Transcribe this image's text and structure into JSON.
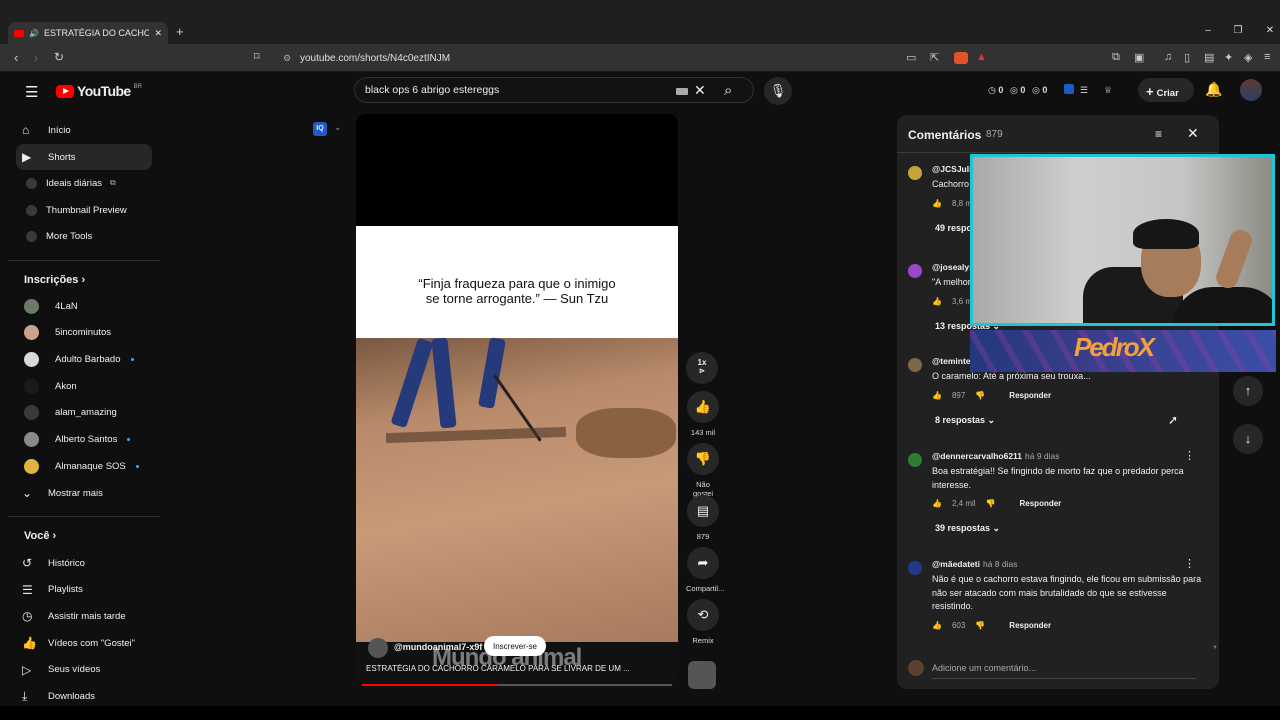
{
  "browser": {
    "tab_title": "ESTRATÉGIA DO CACHORRO",
    "url": "youtube.com/shorts/N4c0eztINJM",
    "window_controls": [
      "–",
      "❐",
      "✕"
    ]
  },
  "masthead": {
    "logo": "YouTube",
    "country": "BR",
    "search_value": "black ops 6 abrigo estereggs",
    "counters": [
      "0",
      "0",
      "0"
    ],
    "create_label": "Criar"
  },
  "sidebar": {
    "main": [
      {
        "label": "Início",
        "icon": "home-icon"
      },
      {
        "label": "Shorts",
        "icon": "shorts-icon"
      },
      {
        "label": "Ideais diárias",
        "icon": "channel-icon"
      },
      {
        "label": "Thumbnail Preview",
        "icon": "channel-icon"
      },
      {
        "label": "More Tools",
        "icon": "channel-icon"
      }
    ],
    "subscriptions_header": "Inscrições",
    "subscriptions": [
      {
        "label": "4LaN",
        "new": false,
        "color": "#6d7a6a"
      },
      {
        "label": "5incominutos",
        "new": false,
        "color": "#c9a38c"
      },
      {
        "label": "Adulto Barbado",
        "new": true,
        "color": "#d8d8d8"
      },
      {
        "label": "Akon",
        "new": false,
        "color": "#1a1a1a"
      },
      {
        "label": "alam_amazing",
        "new": false,
        "color": "#3a3a3a"
      },
      {
        "label": "Alberto Santos",
        "new": true,
        "color": "#8a8a8a"
      },
      {
        "label": "Almanaque SOS",
        "new": true,
        "color": "#e0b440"
      }
    ],
    "show_more": "Mostrar mais",
    "you_header": "Você",
    "you": [
      {
        "label": "Histórico",
        "icon": "history-icon"
      },
      {
        "label": "Playlists",
        "icon": "playlists-icon"
      },
      {
        "label": "Assistir mais tarde",
        "icon": "watch-later-icon"
      },
      {
        "label": "Vídeos com \"Gostei\"",
        "icon": "like-icon"
      },
      {
        "label": "Seus vídeos",
        "icon": "your-videos-icon"
      },
      {
        "label": "Downloads",
        "icon": "download-icon"
      }
    ]
  },
  "short": {
    "quote": "“Finja fraqueza para que o inimigo\nse torne arrogante.” — Sun Tzu",
    "channel": "@mundoanimal7-x9f",
    "subscribe": "Inscrever-se",
    "watermark": "Mundo animal",
    "title": "ESTRATÉGIA DO CACHORRO CARAMELO PARA SE LIVRAR DE UM ...",
    "progress": 0.44,
    "speed": "1x",
    "actions": [
      {
        "name": "like",
        "label": "143 mil",
        "icon": "👍"
      },
      {
        "name": "dislike",
        "label": "Não gostei",
        "icon": "👎"
      },
      {
        "name": "comments",
        "label": "879",
        "icon": "▤"
      },
      {
        "name": "share",
        "label": "Compartil...",
        "icon": "➦"
      },
      {
        "name": "remix",
        "label": "Remix",
        "icon": "⟲"
      }
    ]
  },
  "comments": {
    "title": "Comentários",
    "count": "879",
    "items": [
      {
        "author": "@JCSJuli",
        "time": "",
        "text": "Cachorro",
        "likes": "8,8 mi",
        "replies": "49 respostas",
        "color": "#c9a23a"
      },
      {
        "author": "@josealys",
        "time": "",
        "text": "\"A melhor",
        "likes": "3,6 mi",
        "replies": "13 respostas",
        "color": "#9a47c9"
      },
      {
        "author": "@teminte",
        "time": "",
        "text": "O caramelo:  Até a próxima seu trouxa...",
        "likes": "897",
        "replies": "8 respostas",
        "color": "#7b6a4a"
      },
      {
        "author": "@dennercarvalho6211",
        "time": "há 9 dias",
        "text": "Boa estratégia!! Se fingindo de morto faz que o predador perca interesse.",
        "likes": "2,4 mil",
        "replies": "39 respostas",
        "color": "#2e7d32"
      },
      {
        "author": "@mãedateti",
        "time": "há 8 dias",
        "text": "Não é que o cachorro estava fingindo, ele ficou em submissão para não ser atacado com mais brutalidade do que se estivesse resistindo.",
        "likes": "603",
        "replies": "",
        "color": "#233a8a"
      }
    ],
    "reply_label": "Responder",
    "add_placeholder": "Adicione um comentário..."
  },
  "overlay": {
    "streamer_name": "PedroX"
  }
}
